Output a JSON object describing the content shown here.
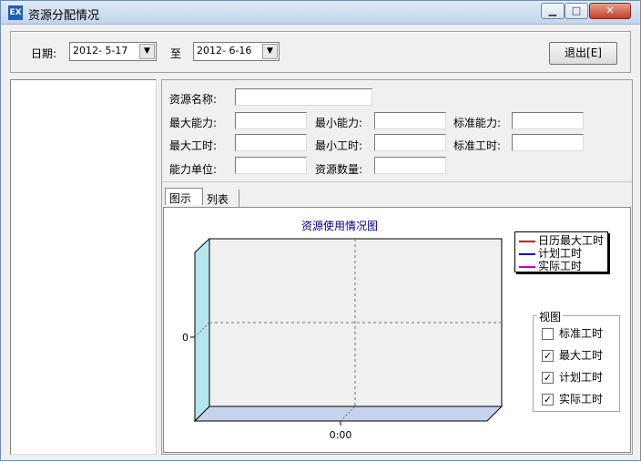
{
  "window": {
    "title": "资源分配情况",
    "app_icon": "EX"
  },
  "toolbar": {
    "date_label": "日期:",
    "start_date": "2012- 5-17",
    "to_label": "至",
    "end_date": "2012- 6-16",
    "exit_button": "退出[E]"
  },
  "form": {
    "resource_name_label": "资源名称:",
    "max_capacity_label": "最大能力:",
    "min_capacity_label": "最小能力:",
    "std_capacity_label": "标准能力:",
    "max_hours_label": "最大工时:",
    "min_hours_label": "最小工时:",
    "std_hours_label": "标准工时:",
    "capacity_unit_label": "能力单位:",
    "resource_qty_label": "资源数量:"
  },
  "tabs": {
    "chart": "图示",
    "list": "列表"
  },
  "chart": {
    "title": "资源使用情况图",
    "y_tick": "0",
    "x_tick": "0:00",
    "legend": [
      {
        "label": "日历最大工时",
        "color": "#d00000"
      },
      {
        "label": "计划工时",
        "color": "#0000c0"
      },
      {
        "label": "实际工时",
        "color": "#c000c0"
      }
    ]
  },
  "chart_data": {
    "type": "area",
    "title": "资源使用情况图",
    "x": [
      "0:00"
    ],
    "yticks": [
      0
    ],
    "series": [
      {
        "name": "日历最大工时",
        "values": []
      },
      {
        "name": "计划工时",
        "values": []
      },
      {
        "name": "实际工时",
        "values": []
      }
    ],
    "grid": true,
    "legend_position": "top-right"
  },
  "view": {
    "title": "视图",
    "options": [
      {
        "label": "标准工时",
        "checked": false
      },
      {
        "label": "最大工时",
        "checked": true
      },
      {
        "label": "计划工时",
        "checked": true
      },
      {
        "label": "实际工时",
        "checked": true
      }
    ]
  }
}
